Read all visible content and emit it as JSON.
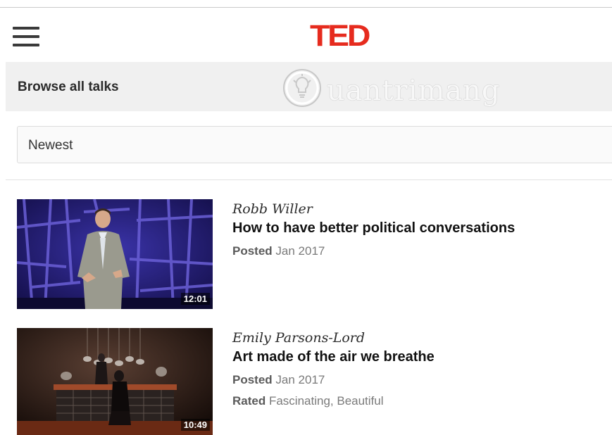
{
  "header": {
    "logo": "TED",
    "menu_icon": "hamburger-menu-icon",
    "brand_color": "#e62b1e"
  },
  "browse": {
    "title": "Browse all talks",
    "watermark": "uantrimang"
  },
  "sort": {
    "selected": "Newest"
  },
  "talks": [
    {
      "speaker": "Robb Willer",
      "title": "How to have better political conversations",
      "posted_label": "Posted",
      "posted_date": "Jan 2017",
      "duration": "12:01"
    },
    {
      "speaker": "Emily Parsons-Lord",
      "title": "Art made of the air we breathe",
      "posted_label": "Posted",
      "posted_date": "Jan 2017",
      "rated_label": "Rated",
      "rated_value": "Fascinating, Beautiful",
      "duration": "10:49"
    }
  ]
}
